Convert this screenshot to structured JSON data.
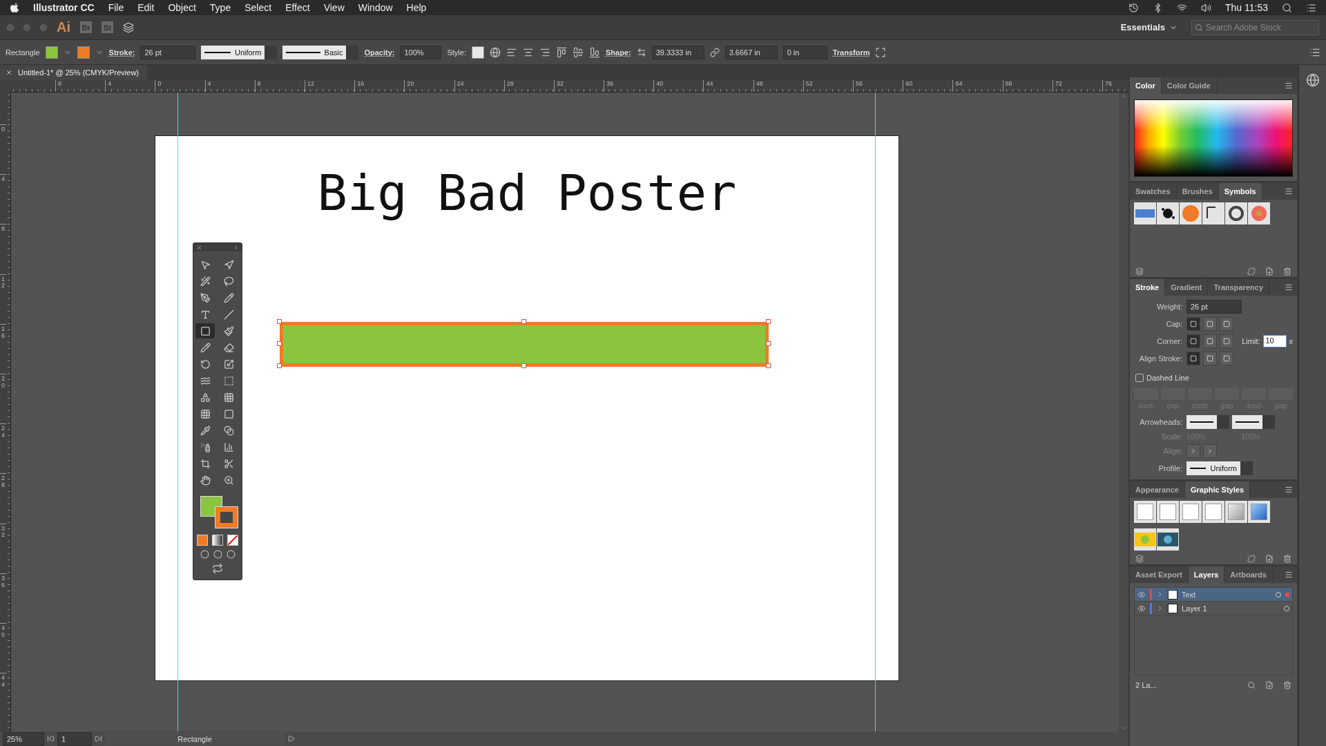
{
  "menu_bar": {
    "app_name": "Illustrator CC",
    "menus": [
      "File",
      "Edit",
      "Object",
      "Type",
      "Select",
      "Effect",
      "View",
      "Window",
      "Help"
    ],
    "clock": "Thu 11:53"
  },
  "app_bar": {
    "logo": "Ai",
    "bridge": "Br",
    "stock": "St",
    "workspace": "Essentials",
    "search": {
      "placeholder": "Search Adobe Stock"
    }
  },
  "control_bar": {
    "selection": "Rectangle",
    "stroke_label": "Stroke:",
    "stroke_weight": "26 pt",
    "profile": "Uniform",
    "brush": "Basic",
    "opacity_label": "Opacity:",
    "opacity": "100%",
    "style_label": "Style:",
    "shape_label": "Shape:",
    "width": "39.3333 in",
    "height": "3.6667 in",
    "corner_radius": "0 in",
    "transform": "Transform"
  },
  "document_tab": {
    "title": "Untitled-1* @ 25% (CMYK/Preview)"
  },
  "rulers": {
    "horizontal": [
      "8",
      "4",
      "0",
      "4",
      "8",
      "12",
      "16",
      "20",
      "24",
      "28",
      "32",
      "36",
      "40",
      "44",
      "48",
      "52",
      "56",
      "60",
      "64",
      "68",
      "72",
      "76"
    ],
    "vertical": [
      "0",
      "4",
      "8",
      "12",
      "16",
      "20",
      "24",
      "28",
      "32",
      "36",
      "40",
      "44"
    ]
  },
  "artboard": {
    "title": "Big Bad Poster",
    "rectangle": {
      "selected": true
    }
  },
  "toolbox": {
    "tools": [
      {
        "selected": false
      },
      {
        "selected": false
      },
      {
        "selected": false
      },
      {
        "selected": false
      },
      {
        "selected": false
      },
      {
        "selected": false
      },
      {
        "selected": false
      },
      {
        "selected": false
      },
      {
        "selected": true
      },
      {
        "selected": false
      },
      {
        "selected": false
      },
      {
        "selected": false
      },
      {
        "selected": false
      },
      {
        "selected": false
      },
      {
        "selected": false
      },
      {
        "selected": false
      },
      {
        "selected": false
      },
      {
        "selected": false
      },
      {
        "selected": false
      },
      {
        "selected": false
      },
      {
        "selected": false
      },
      {
        "selected": false
      },
      {
        "selected": false
      },
      {
        "selected": false
      },
      {
        "selected": false
      },
      {
        "selected": false
      }
    ]
  },
  "color_panel": {
    "tabs": [
      {
        "label": "Color",
        "selected": true
      },
      {
        "label": "Color Guide",
        "selected": false
      }
    ]
  },
  "symbols_panel": {
    "tabs": [
      {
        "label": "Swatches",
        "selected": false
      },
      {
        "label": "Brushes",
        "selected": false
      },
      {
        "label": "Symbols",
        "selected": true
      }
    ]
  },
  "stroke_panel": {
    "tabs": [
      {
        "label": "Stroke",
        "selected": true
      },
      {
        "label": "Gradient",
        "selected": false
      },
      {
        "label": "Transparency",
        "selected": false
      }
    ],
    "weight_label": "Weight:",
    "weight": "26 pt",
    "cap_label": "Cap:",
    "caps": [
      {
        "selected": true
      },
      {
        "selected": false
      },
      {
        "selected": false
      }
    ],
    "corner_label": "Corner:",
    "corners": [
      {
        "selected": true
      },
      {
        "selected": false
      },
      {
        "selected": false
      }
    ],
    "limit_label": "Limit:",
    "limit": "10",
    "limit_unit": "x",
    "align_label": "Align Stroke:",
    "aligns": [
      {
        "selected": true
      },
      {
        "selected": false
      },
      {
        "selected": false
      }
    ],
    "dashed_line": {
      "label": "Dashed Line",
      "checked": false
    },
    "dash_fields": [
      "dash",
      "gap",
      "dash",
      "gap",
      "dash",
      "gap"
    ],
    "arrowheads_label": "Arrowheads:",
    "arrow_options_disabled": true,
    "scale_label": "Scale:",
    "scale_start": "100%",
    "scale_end": "100%",
    "arrow_align_label": "Align:",
    "profile_label": "Profile:",
    "profile": "Uniform"
  },
  "graphic_styles_panel": {
    "tabs": [
      {
        "label": "Appearance",
        "selected": false
      },
      {
        "label": "Graphic Styles",
        "selected": true
      }
    ]
  },
  "layers_panel": {
    "tabs": [
      {
        "label": "Asset Export",
        "selected": false
      },
      {
        "label": "Layers",
        "selected": true
      },
      {
        "label": "Artboards",
        "selected": false
      }
    ],
    "layers": [
      {
        "name": "Text",
        "color": "#e8464a",
        "selected": true
      },
      {
        "name": "Layer 1",
        "color": "#4a7cf0",
        "selected": false
      }
    ],
    "count": "2 La..."
  },
  "status_bar": {
    "zoom": "25%",
    "artboard": "1",
    "tool": "Rectangle"
  }
}
